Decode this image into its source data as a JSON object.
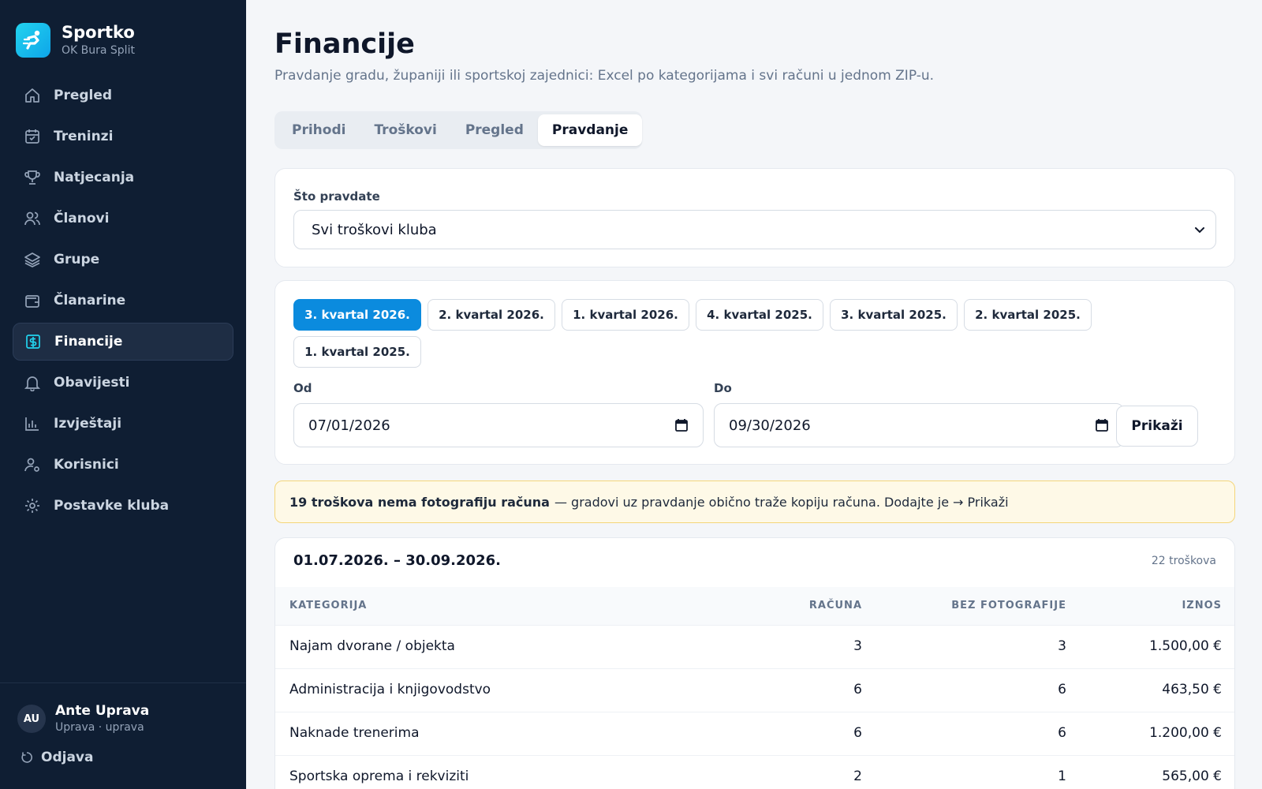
{
  "brand": {
    "name": "Sportko",
    "club": "OK Bura Split"
  },
  "nav": {
    "items": [
      {
        "label": "Pregled",
        "icon": "home-icon"
      },
      {
        "label": "Treninzi",
        "icon": "calendar-icon"
      },
      {
        "label": "Natjecanja",
        "icon": "trophy-icon"
      },
      {
        "label": "Članovi",
        "icon": "users-icon"
      },
      {
        "label": "Grupe",
        "icon": "layers-icon"
      },
      {
        "label": "Članarine",
        "icon": "wallet-icon"
      },
      {
        "label": "Financije",
        "icon": "dollar-icon",
        "active": true
      },
      {
        "label": "Obavijesti",
        "icon": "bell-icon"
      },
      {
        "label": "Izvještaji",
        "icon": "bar-chart-icon"
      },
      {
        "label": "Korisnici",
        "icon": "user-cog-icon"
      },
      {
        "label": "Postavke kluba",
        "icon": "gear-icon"
      }
    ]
  },
  "user": {
    "initials": "AU",
    "name": "Ante Uprava",
    "role": "Uprava · uprava"
  },
  "logout_label": "Odjava",
  "page": {
    "title": "Financije",
    "subtitle": "Pravdanje gradu, županiji ili sportskoj zajednici: Excel po kategorijama i svi računi u jednom ZIP-u."
  },
  "tabs": [
    {
      "label": "Prihodi"
    },
    {
      "label": "Troškovi"
    },
    {
      "label": "Pregled"
    },
    {
      "label": "Pravdanje",
      "active": true
    }
  ],
  "scope": {
    "label": "Što pravdate",
    "value": "Svi troškovi kluba"
  },
  "quarters": [
    {
      "label": "3. kvartal 2026.",
      "active": true
    },
    {
      "label": "2. kvartal 2026."
    },
    {
      "label": "1. kvartal 2026."
    },
    {
      "label": "4. kvartal 2025."
    },
    {
      "label": "3. kvartal 2025."
    },
    {
      "label": "2. kvartal 2025."
    },
    {
      "label": "1. kvartal 2025."
    }
  ],
  "date_range": {
    "from_label": "Od",
    "from_value": "07/01/2026",
    "to_label": "Do",
    "to_value": "09/30/2026",
    "show_label": "Prikaži"
  },
  "alert": {
    "bold": "19 troškova nema fotografiju računa",
    "text": "— gradovi uz pravdanje obično traže kopiju računa. Dodajte je",
    "link": "→ Prikaži"
  },
  "summary": {
    "range_title": "01.07.2026. – 30.09.2026.",
    "count": "22 troškova",
    "columns": [
      "KATEGORIJA",
      "RAČUNA",
      "BEZ FOTOGRAFIJE",
      "IZNOS"
    ],
    "rows": [
      {
        "category": "Najam dvorane / objekta",
        "count": "3",
        "no_photo": "3",
        "amount": "1.500,00 €"
      },
      {
        "category": "Administracija i knjigovodstvo",
        "count": "6",
        "no_photo": "6",
        "amount": "463,50 €"
      },
      {
        "category": "Naknade trenerima",
        "count": "6",
        "no_photo": "6",
        "amount": "1.200,00 €"
      },
      {
        "category": "Sportska oprema i rekviziti",
        "count": "2",
        "no_photo": "1",
        "amount": "565,00 €"
      }
    ]
  },
  "colors": {
    "sidebar_bg": "#0f1e33",
    "accent": "#0b8bde",
    "alert_bg": "#fef9e7",
    "alert_border": "#f4d67a"
  }
}
